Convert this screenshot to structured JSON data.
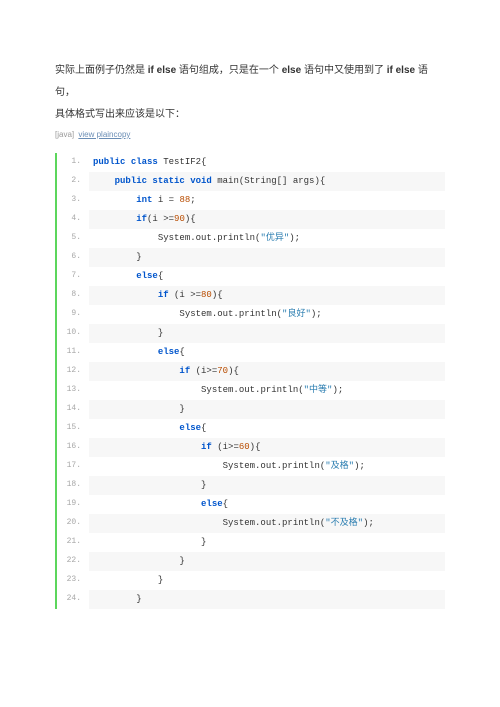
{
  "intro": {
    "pre1": "实际上面例子仍然是 ",
    "kw1": "if else",
    "mid1": " 语句组成，只是在一个 ",
    "kw2": "else",
    "mid2": " 语句中又使用到了 ",
    "kw3": "if else",
    "mid3": " 语句，",
    "line2": "具体格式写出来应该是以下："
  },
  "meta": {
    "lang": "[java]",
    "link": "view plaincopy"
  },
  "code": [
    {
      "n": "1.",
      "ind": 0,
      "tokens": [
        [
          "kw",
          "public"
        ],
        [
          "pl",
          " "
        ],
        [
          "kw",
          "class"
        ],
        [
          "pl",
          " TestIF2{"
        ]
      ]
    },
    {
      "n": "2.",
      "ind": 1,
      "tokens": [
        [
          "kw",
          "public"
        ],
        [
          "pl",
          " "
        ],
        [
          "kw",
          "static"
        ],
        [
          "pl",
          " "
        ],
        [
          "kw",
          "void"
        ],
        [
          "pl",
          " main(String[] args){"
        ]
      ]
    },
    {
      "n": "3.",
      "ind": 2,
      "tokens": [
        [
          "kw",
          "int"
        ],
        [
          "pl",
          " i = "
        ],
        [
          "num",
          "88"
        ],
        [
          "pl",
          ";"
        ]
      ]
    },
    {
      "n": "4.",
      "ind": 2,
      "tokens": [
        [
          "kw",
          "if"
        ],
        [
          "pl",
          "(i >="
        ],
        [
          "num",
          "90"
        ],
        [
          "pl",
          "){"
        ]
      ]
    },
    {
      "n": "5.",
      "ind": 3,
      "tokens": [
        [
          "pl",
          "System.out.println("
        ],
        [
          "str",
          "\"优异\""
        ],
        [
          "pl",
          ");"
        ]
      ]
    },
    {
      "n": "6.",
      "ind": 2,
      "tokens": [
        [
          "pl",
          "}"
        ]
      ]
    },
    {
      "n": "7.",
      "ind": 2,
      "tokens": [
        [
          "kw",
          "else"
        ],
        [
          "pl",
          "{"
        ]
      ]
    },
    {
      "n": "8.",
      "ind": 3,
      "tokens": [
        [
          "kw",
          "if"
        ],
        [
          "pl",
          " (i >="
        ],
        [
          "num",
          "80"
        ],
        [
          "pl",
          "){"
        ]
      ]
    },
    {
      "n": "9.",
      "ind": 4,
      "tokens": [
        [
          "pl",
          "System.out.println("
        ],
        [
          "str",
          "\"良好\""
        ],
        [
          "pl",
          ");"
        ]
      ]
    },
    {
      "n": "10.",
      "ind": 3,
      "tokens": [
        [
          "pl",
          "}"
        ]
      ]
    },
    {
      "n": "11.",
      "ind": 3,
      "tokens": [
        [
          "kw",
          "else"
        ],
        [
          "pl",
          "{"
        ]
      ]
    },
    {
      "n": "12.",
      "ind": 4,
      "tokens": [
        [
          "kw",
          "if"
        ],
        [
          "pl",
          " (i>="
        ],
        [
          "num",
          "70"
        ],
        [
          "pl",
          "){"
        ]
      ]
    },
    {
      "n": "13.",
      "ind": 5,
      "tokens": [
        [
          "pl",
          "System.out.println("
        ],
        [
          "str",
          "\"中等\""
        ],
        [
          "pl",
          ");"
        ]
      ]
    },
    {
      "n": "14.",
      "ind": 4,
      "tokens": [
        [
          "pl",
          "}"
        ]
      ]
    },
    {
      "n": "15.",
      "ind": 4,
      "tokens": [
        [
          "kw",
          "else"
        ],
        [
          "pl",
          "{"
        ]
      ]
    },
    {
      "n": "16.",
      "ind": 5,
      "tokens": [
        [
          "kw",
          "if"
        ],
        [
          "pl",
          " (i>="
        ],
        [
          "num",
          "60"
        ],
        [
          "pl",
          "){"
        ]
      ]
    },
    {
      "n": "17.",
      "ind": 6,
      "tokens": [
        [
          "pl",
          "System.out.println("
        ],
        [
          "str",
          "\"及格\""
        ],
        [
          "pl",
          ");"
        ]
      ]
    },
    {
      "n": "18.",
      "ind": 5,
      "tokens": [
        [
          "pl",
          "}"
        ]
      ]
    },
    {
      "n": "19.",
      "ind": 5,
      "tokens": [
        [
          "kw",
          "else"
        ],
        [
          "pl",
          "{"
        ]
      ]
    },
    {
      "n": "20.",
      "ind": 6,
      "tokens": [
        [
          "pl",
          "System.out.println("
        ],
        [
          "str",
          "\"不及格\""
        ],
        [
          "pl",
          ");"
        ]
      ]
    },
    {
      "n": "21.",
      "ind": 5,
      "tokens": [
        [
          "pl",
          "}"
        ]
      ]
    },
    {
      "n": "22.",
      "ind": 4,
      "tokens": [
        [
          "pl",
          "}"
        ]
      ]
    },
    {
      "n": "23.",
      "ind": 3,
      "tokens": [
        [
          "pl",
          "}"
        ]
      ]
    },
    {
      "n": "24.",
      "ind": 2,
      "tokens": [
        [
          "pl",
          "}"
        ]
      ]
    }
  ]
}
